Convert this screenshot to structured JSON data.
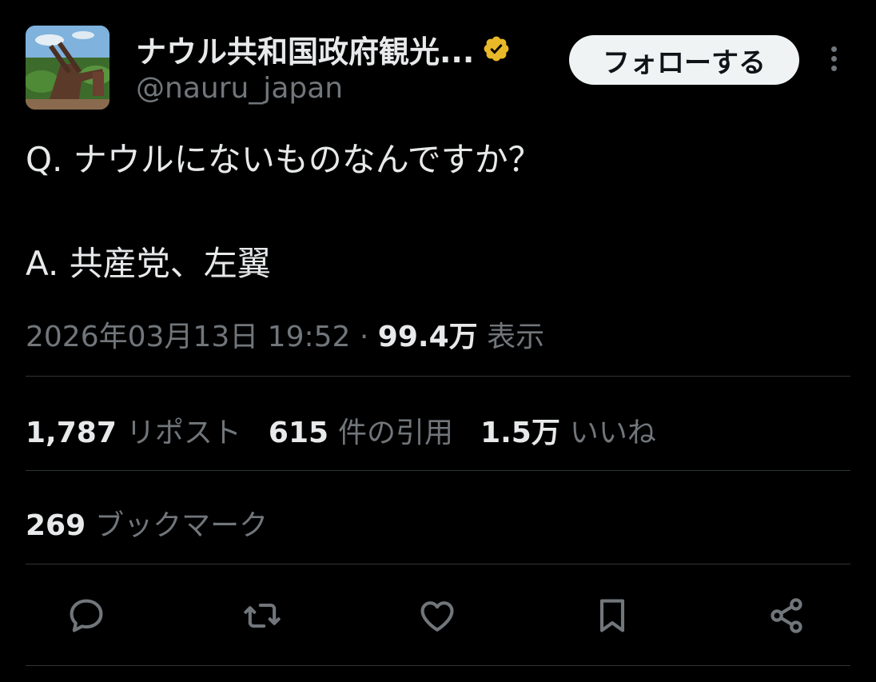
{
  "author": {
    "display_name": "ナウル共和国政府観光...",
    "handle": "@nauru_japan",
    "verified_badge_color": "#e8b829"
  },
  "header": {
    "follow_label": "フォローする",
    "more_icon": "more-vertical-icon"
  },
  "tweet": {
    "line1": "Q. ナウルにないものなんですか？",
    "line2": "A. 共産党、左翼",
    "timestamp": "2026年03月13日 19:52",
    "separator": "·",
    "views_count": "99.4万",
    "views_label": "表示"
  },
  "stats": {
    "reposts_count": "1,787",
    "reposts_label": "リポスト",
    "quotes_count": "615",
    "quotes_label": "件の引用",
    "likes_count": "1.5万",
    "likes_label": "いいね",
    "bookmarks_count": "269",
    "bookmarks_label": "ブックマーク"
  },
  "actions": [
    "reply-icon",
    "repost-icon",
    "like-icon",
    "bookmark-icon",
    "share-icon"
  ],
  "colors": {
    "background": "#000000",
    "text_primary": "#e7e9ea",
    "text_secondary": "#71767b",
    "divider": "#2f3336",
    "follow_bg": "#eff3f4"
  }
}
